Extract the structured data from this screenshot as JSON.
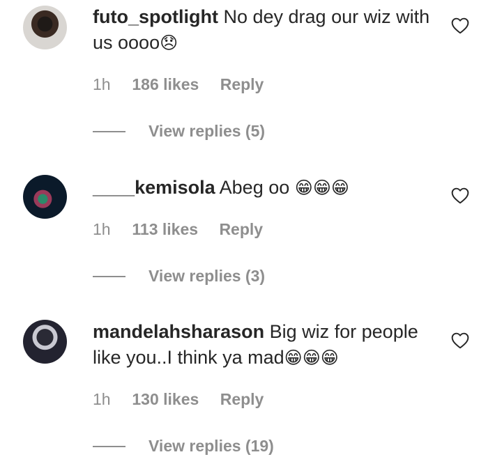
{
  "comments": [
    {
      "username": "futo_spotlight",
      "text": "No dey drag our wiz with us oooo",
      "emoji": "😞",
      "time": "1h",
      "likes": "186 likes",
      "reply": "Reply",
      "view_replies": "View replies (5)",
      "avatar": "avatar-woman-portrait",
      "liked": false
    },
    {
      "username": "____kemisola",
      "text": "Abeg oo",
      "emoji": "😁😁😁",
      "time": "1h",
      "likes": "113 likes",
      "reply": "Reply",
      "view_replies": "View replies (3)",
      "avatar": "avatar-car-photo",
      "liked": false
    },
    {
      "username": "mandelahsharason",
      "text": "Big wiz for people like you..I think ya mad",
      "emoji": "😁😁😁",
      "time": "1h",
      "likes": "130 likes",
      "reply": "Reply",
      "view_replies": "View replies (19)",
      "avatar": "avatar-man-portrait",
      "liked": false
    }
  ],
  "colors": {
    "text": "#262626",
    "secondary": "#8e8e8e",
    "background": "#ffffff"
  },
  "icons": {
    "like": "heart-outline-icon"
  }
}
